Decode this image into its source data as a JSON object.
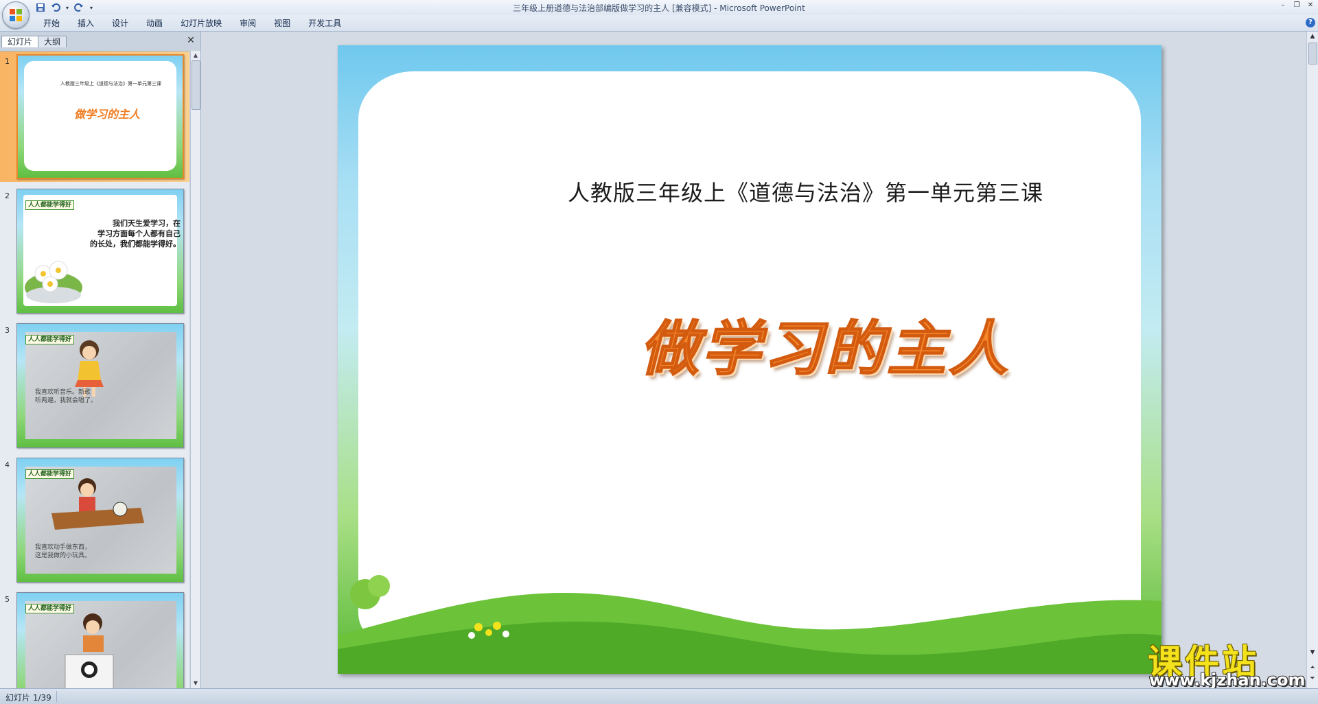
{
  "window": {
    "title": "三年级上册道德与法治部编版做学习的主人 [兼容模式] - Microsoft PowerPoint",
    "controls": [
      "–",
      "❐",
      "✕"
    ]
  },
  "ribbon": {
    "tabs": [
      "开始",
      "插入",
      "设计",
      "动画",
      "幻灯片放映",
      "审阅",
      "视图",
      "开发工具"
    ]
  },
  "pane": {
    "tab_slides": "幻灯片",
    "tab_outline": "大纲",
    "close": "✕"
  },
  "thumbnails": [
    {
      "number": "1",
      "small": "人教版三年级上《道德与法治》第一单元第三课",
      "title": "做学习的主人"
    },
    {
      "number": "2",
      "tag": "人人都能学得好",
      "text": "我们天生爱学习，在\n学习方面每个人都有自己\n的长处，我们都能学得好。"
    },
    {
      "number": "3",
      "tag": "人人都能学得好",
      "caption": "我喜欢听音乐。新歌\n听两遍，我就会唱了。"
    },
    {
      "number": "4",
      "tag": "人人都能学得好",
      "caption": "我喜欢动手做东西，\n这是我做的小玩具。"
    },
    {
      "number": "5",
      "tag": "人人都能学得好"
    }
  ],
  "slide": {
    "subtitle": "人教版三年级上《道德与法治》第一单元第三课",
    "title": "做学习的主人"
  },
  "watermark": {
    "chinese": "课件站",
    "url": "www.kjzhan.com"
  },
  "status": {
    "slide_indicator": "幻灯片 1/39"
  },
  "colors": {
    "title_orange": "#f6862a",
    "selection": "#f9b463",
    "watermark_yellow": "#f4e21c"
  }
}
